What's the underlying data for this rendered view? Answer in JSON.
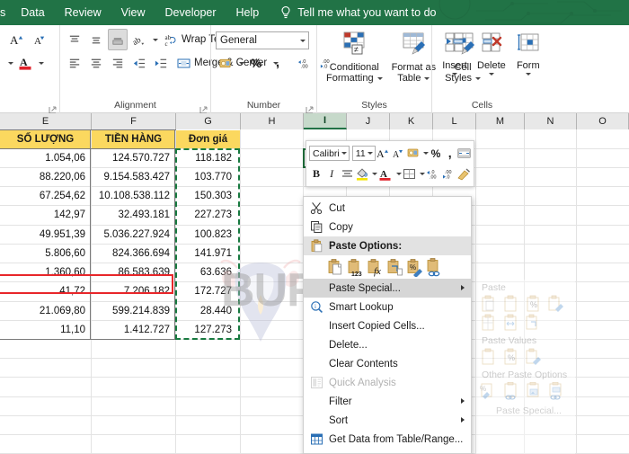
{
  "ribbon_tabs": {
    "clipped_first": "s",
    "items": [
      "Data",
      "Review",
      "View",
      "Developer",
      "Help"
    ],
    "tellme": "Tell me what you want to do",
    "bulb_icon": "lightbulb-icon"
  },
  "ribbon": {
    "groups": [
      {
        "name": "font",
        "label": "",
        "buttons": [
          "increase-font-size",
          "decrease-font-size",
          "font-color"
        ]
      },
      {
        "name": "alignment",
        "label": "Alignment",
        "buttons": [
          "align-top",
          "align-middle",
          "align-bottom",
          "orientation",
          "wrap-text",
          "align-left",
          "align-center",
          "align-right",
          "decrease-indent",
          "increase-indent",
          "merge-center"
        ],
        "wrap_text_label": "Wrap Text",
        "merge_label": "Merge & Center"
      },
      {
        "name": "number",
        "label": "Number",
        "format_value": "General",
        "buttons": [
          "accounting-number-format",
          "percent-style",
          "comma-style",
          "increase-decimal",
          "decrease-decimal"
        ]
      },
      {
        "name": "styles",
        "label": "Styles",
        "items": [
          {
            "label1": "Conditional",
            "label2": "Formatting",
            "icon": "conditional-formatting-icon",
            "dropdown": true
          },
          {
            "label1": "Format as",
            "label2": "Table",
            "icon": "format-as-table-icon",
            "dropdown": true
          },
          {
            "label1": "Cell",
            "label2": "Styles",
            "icon": "cell-styles-icon",
            "dropdown": true
          }
        ]
      },
      {
        "name": "cells",
        "label": "Cells",
        "items": [
          {
            "label1": "Insert",
            "label2": "",
            "icon": "insert-cells-icon",
            "dropdown": true
          },
          {
            "label1": "Delete",
            "label2": "",
            "icon": "delete-cells-icon",
            "dropdown": true
          },
          {
            "label1": "Form",
            "label2": "",
            "icon": "format-cells-icon",
            "dropdown": true
          }
        ]
      }
    ]
  },
  "grid": {
    "column_headers": [
      "E",
      "F",
      "G",
      "H",
      "I",
      "J",
      "K",
      "L",
      "M",
      "N",
      "O"
    ],
    "selected_column": "I",
    "header_row": [
      "SỐ LƯỢNG",
      "TIỀN HÀNG",
      "Đơn giá"
    ],
    "header_fill": "#FBD85F",
    "rows": [
      {
        "E": "1.054,06",
        "F": "124.570.727",
        "G": "118.182"
      },
      {
        "E": "88.220,06",
        "F": "9.154.583.427",
        "G": "103.770"
      },
      {
        "E": "67.254,62",
        "F": "10.108.538.112",
        "G": "150.303"
      },
      {
        "E": "142,97",
        "F": "32.493.181",
        "G": "227.273"
      },
      {
        "E": "49.951,39",
        "F": "5.036.227.924",
        "G": "100.823"
      },
      {
        "E": "5.806,60",
        "F": "824.366.694",
        "G": "141.971"
      },
      {
        "E": "1.360,60",
        "F": "86.583.639",
        "G": "63.636"
      },
      {
        "E": "41,72",
        "F": "7.206.182",
        "G": "172.727"
      },
      {
        "E": "21.069,80",
        "F": "599.214.839",
        "G": "28.440"
      },
      {
        "E": "11,10",
        "F": "1.412.727",
        "G": "127.273"
      }
    ],
    "marquee_column": "G",
    "marquee_color": "#17793f",
    "watermark_text": "BUFF.COM",
    "watermark_icon": "bull-head-icon"
  },
  "mini_toolbar": {
    "font_name": "Calibri",
    "font_size": "11",
    "buttons": [
      "grow-font-icon",
      "shrink-font-icon",
      "accounting-format-icon",
      "percent-icon",
      "comma-icon",
      "merge-center-icon",
      "bold-icon",
      "italic-icon",
      "center-align-icon",
      "fill-color-icon",
      "font-color-icon",
      "borders-icon",
      "increase-decimal-icon",
      "decrease-decimal-icon",
      "format-painter-icon"
    ],
    "bold_label": "B",
    "italic_label": "I",
    "percent_label": "%",
    "comma_label": ","
  },
  "context_menu": {
    "items": [
      {
        "label": "Cut",
        "icon": "scissors-icon",
        "type": "item",
        "disabled": false,
        "submenu": false
      },
      {
        "label": "Copy",
        "icon": "copy-icon",
        "type": "item",
        "disabled": false,
        "submenu": false
      },
      {
        "label": "Paste Options:",
        "icon": "paste-icon",
        "type": "header",
        "disabled": false,
        "submenu": false
      },
      {
        "label": "Paste Special...",
        "icon": "",
        "type": "item",
        "disabled": false,
        "submenu": true,
        "highlighted": true
      },
      {
        "label": "Smart Lookup",
        "icon": "smart-lookup-icon",
        "type": "item",
        "disabled": false,
        "submenu": false
      },
      {
        "label": "Insert Copied Cells...",
        "icon": "",
        "type": "item",
        "disabled": false,
        "submenu": false
      },
      {
        "label": "Delete...",
        "icon": "",
        "type": "item",
        "disabled": false,
        "submenu": false
      },
      {
        "label": "Clear Contents",
        "icon": "",
        "type": "item",
        "disabled": false,
        "submenu": false
      },
      {
        "label": "Quick Analysis",
        "icon": "quick-analysis-icon",
        "type": "item",
        "disabled": true,
        "submenu": false
      },
      {
        "label": "Filter",
        "icon": "",
        "type": "item",
        "disabled": false,
        "submenu": true
      },
      {
        "label": "Sort",
        "icon": "",
        "type": "item",
        "disabled": false,
        "submenu": true
      },
      {
        "label": "Get Data from Table/Range...",
        "icon": "table-icon",
        "type": "item",
        "disabled": false,
        "submenu": false
      }
    ],
    "paste_option_icons": [
      "paste-all-icon",
      "paste-values-icon",
      "paste-formulas-icon",
      "paste-transpose-icon",
      "paste-formatting-icon",
      "paste-link-icon"
    ],
    "highlight_color": "#e8262a"
  },
  "ghost_submenu": {
    "sections": [
      {
        "title": "Paste",
        "icon_count": 7
      },
      {
        "title": "Paste Values",
        "icon_count": 3
      },
      {
        "title": "Other Paste Options",
        "icon_count": 4
      }
    ],
    "footer": "Paste Special..."
  }
}
